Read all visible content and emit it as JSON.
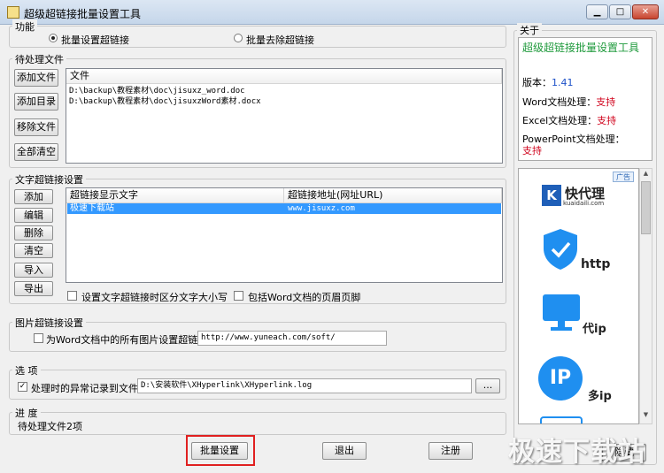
{
  "window": {
    "title": "超级超链接批量设置工具"
  },
  "func": {
    "legend": "功能",
    "opt_set": "批量设置超链接",
    "opt_remove": "批量去除超链接"
  },
  "pending": {
    "legend": "待处理文件",
    "buttons": [
      "添加文件",
      "添加目录",
      "移除文件",
      "全部清空"
    ],
    "col_header": "文件",
    "files": [
      "D:\\backup\\教程素材\\doc\\jisuxz_word.doc",
      "D:\\backup\\教程素材\\doc\\jisuxzWord素材.docx"
    ]
  },
  "text_links": {
    "legend": "文字超链接设置",
    "buttons": [
      "添加",
      "编辑",
      "删除",
      "清空",
      "导入",
      "导出"
    ],
    "col_text": "超链接显示文字",
    "col_url": "超链接地址(网址URL)",
    "rows": [
      {
        "text": "极速下载站",
        "url": "www.jisuxz.com"
      }
    ],
    "chk_case": "设置文字超链接时区分文字大小写",
    "chk_header": "包括Word文档的页眉页脚"
  },
  "image_links": {
    "legend": "图片超链接设置",
    "label": "为Word文档中的所有图片设置超链接:",
    "url": "http://www.yuneach.com/soft/"
  },
  "options": {
    "legend": "选 项",
    "log_label": "处理时的异常记录到文件:",
    "log_path": "D:\\安装软件\\XHyperlink\\XHyperlink.log",
    "browse": "..."
  },
  "progress": {
    "legend": "进 度",
    "status": "待处理文件2项"
  },
  "bottom": {
    "batch": "批量设置",
    "exit": "退出",
    "register": "注册"
  },
  "about": {
    "legend": "关于",
    "title": "超级超链接批量设置工具",
    "version_label": "版本：",
    "version": "1.41",
    "word_label": "Word文档处理：",
    "word_val": "支持",
    "excel_label": "Excel文档处理：",
    "excel_val": "支持",
    "ppt_label": "PowerPoint文档处理：",
    "ppt_val": "支持",
    "hide": "隐藏"
  },
  "ad": {
    "tag": "广告",
    "brand": "快代理",
    "brand_url": "kuaidaili.com",
    "labels": [
      "http",
      "代ip",
      "多ip"
    ],
    "ip_text": "IP"
  },
  "watermark": "极速下载站",
  "colors": {
    "accent_green": "#1f9a3c",
    "support_red": "#d0021b",
    "version_blue": "#1c50c8",
    "select_blue": "#3399ff",
    "icon_blue": "#1f8ff0"
  }
}
